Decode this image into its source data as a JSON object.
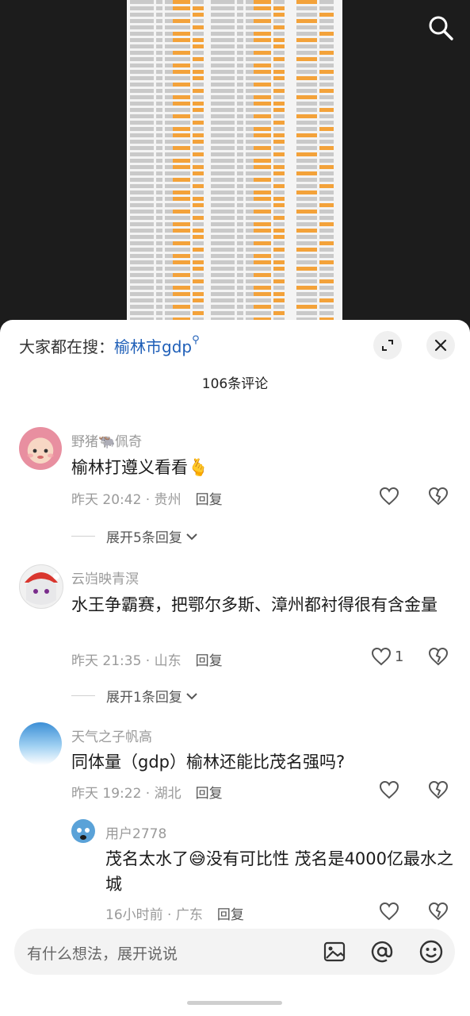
{
  "search": {
    "prefix": "大家都在搜：",
    "keyword": "榆林市gdp",
    "icon": "search-icon"
  },
  "comment_count": "106条评论",
  "comments": [
    {
      "user": "野猪🐃佩奇",
      "text": "榆林打遵义看看🫰",
      "time": "昨天 20:42 · 贵州",
      "reply_label": "回复",
      "likes": "",
      "expand_label": "展开5条回复"
    },
    {
      "user": "云岿映青溟",
      "text": "水王争霸赛，把鄂尔多斯、漳州都衬得很有含金量",
      "time": "昨天 21:35 · 山东",
      "reply_label": "回复",
      "likes": "1",
      "expand_label": "展开1条回复"
    },
    {
      "user": "天气之子帆高",
      "text": "同体量（gdp）榆林还能比茂名强吗?",
      "time": "昨天 19:22 · 湖北",
      "reply_label": "回复",
      "likes": ""
    }
  ],
  "sub_reply": {
    "user": "用户2778",
    "text": "茂名太水了😅没有可比性 茂名是4000亿最水之城",
    "time": "16小时前 · 广东",
    "reply_label": "回复"
  },
  "input": {
    "placeholder": "有什么想法，展开说说"
  },
  "colors": {
    "keyword": "#1f5fb8",
    "sheet_highlight": "#f3a23a"
  }
}
